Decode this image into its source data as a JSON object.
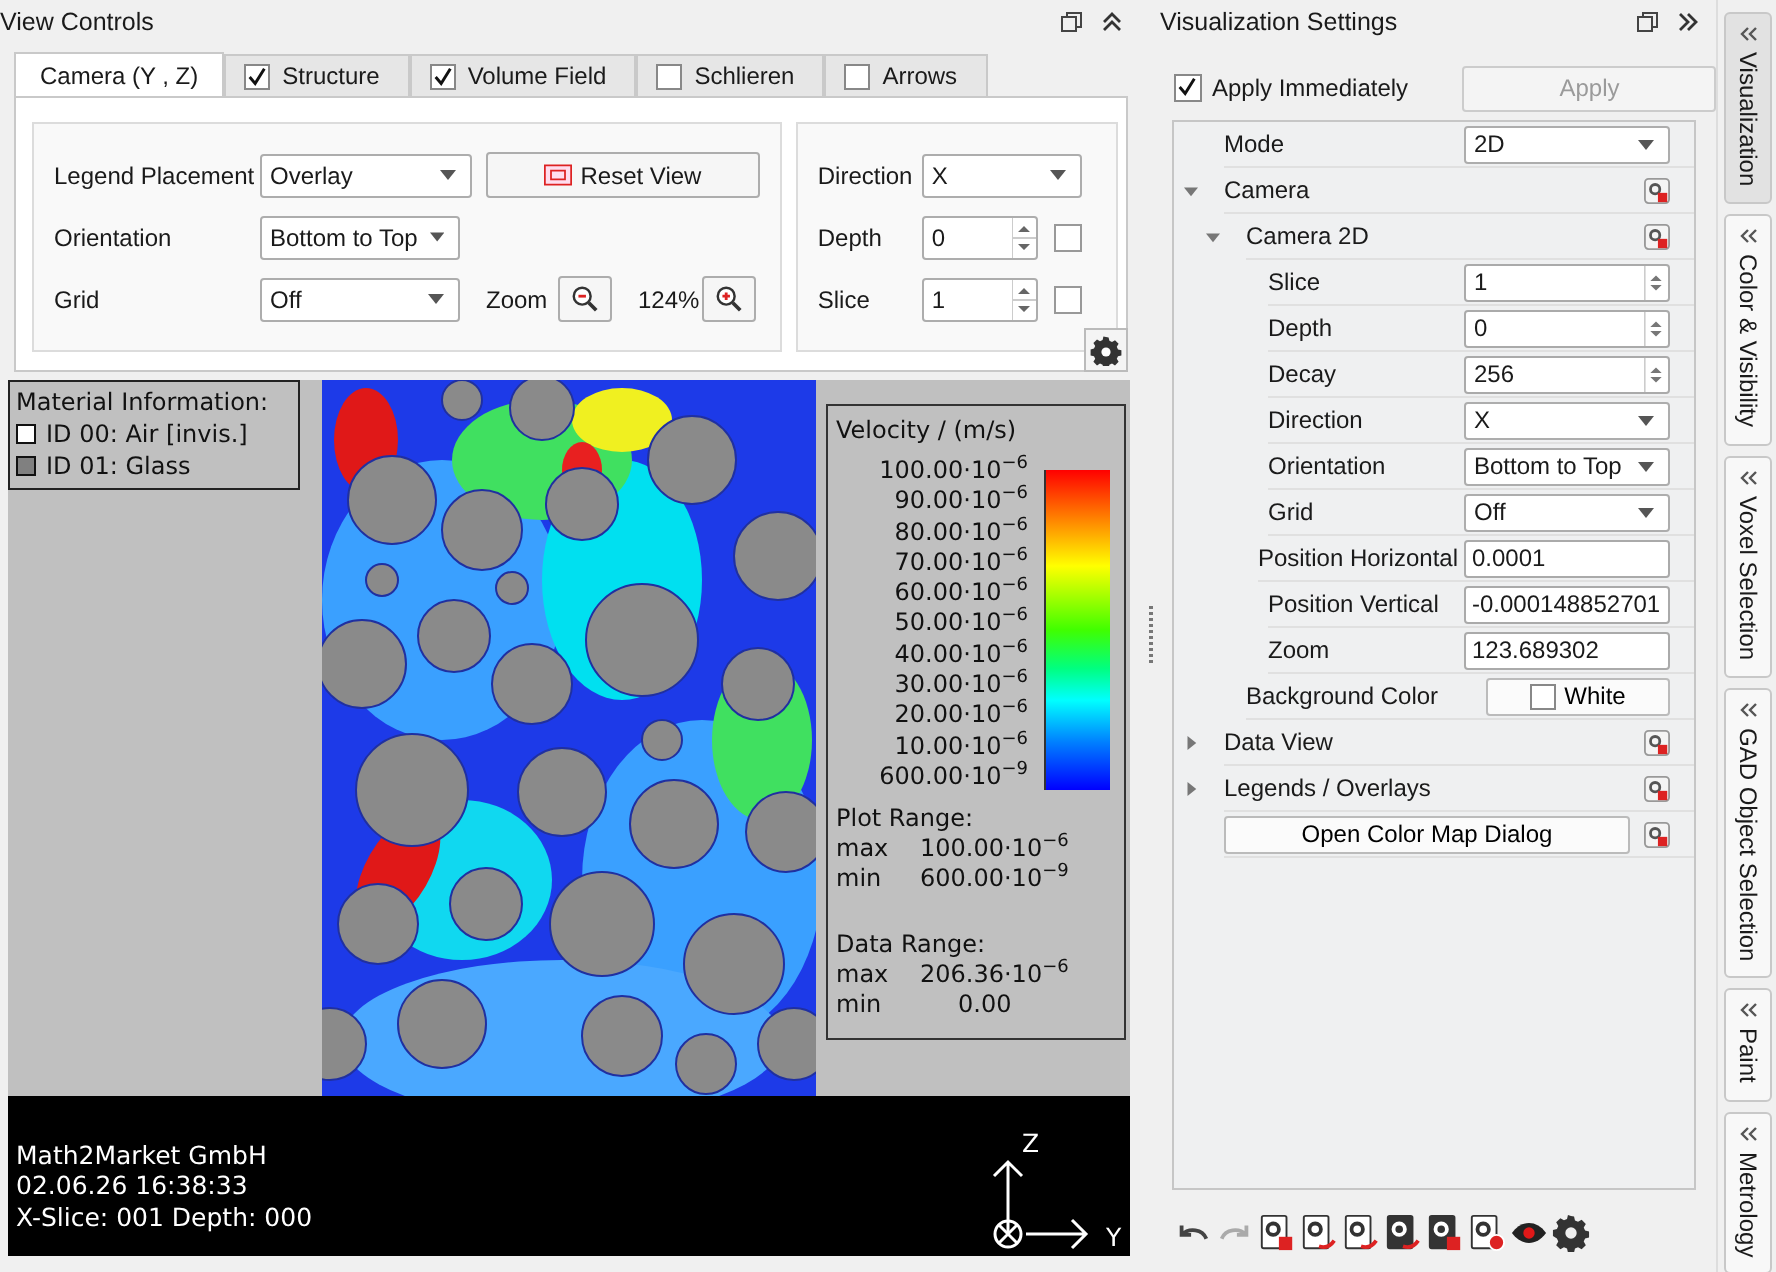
{
  "view_controls": {
    "title": "View Controls",
    "tabs": [
      {
        "kind": "plain",
        "label": "Camera (Y , Z)",
        "selected": true
      },
      {
        "kind": "check",
        "label": "Structure",
        "selected": false,
        "checked": true
      },
      {
        "kind": "check",
        "label": "Volume Field",
        "selected": false,
        "checked": true
      },
      {
        "kind": "check",
        "label": "Schlieren",
        "selected": false,
        "checked": false
      },
      {
        "kind": "check",
        "label": "Arrows",
        "selected": false,
        "checked": false
      }
    ],
    "camera": {
      "legend_placement": {
        "label": "Legend Placement",
        "value": "Overlay"
      },
      "reset_view": "Reset View",
      "orientation": {
        "label": "Orientation",
        "value": "Bottom to Top"
      },
      "grid": {
        "label": "Grid",
        "value": "Off"
      },
      "zoom": {
        "label": "Zoom",
        "value": "124%"
      },
      "direction": {
        "label": "Direction",
        "value": "X"
      },
      "depth": {
        "label": "Depth",
        "value": "0",
        "checked": false
      },
      "slice": {
        "label": "Slice",
        "value": "1",
        "checked": false
      }
    },
    "viewport": {
      "material_title": "Material Information:",
      "materials": [
        {
          "label": "ID 00: Air [invis.]",
          "color": "#ffffff"
        },
        {
          "label": "ID 01: Glass",
          "color": "#808080"
        }
      ],
      "legend": {
        "title": "Velocity / (m/s)",
        "ticks": [
          "100.00·10$^{−6}$",
          "90.00·10$^{−6}$",
          "80.00·10$^{−6}$",
          "70.00·10$^{−6}$",
          "60.00·10$^{−6}$",
          "50.00·10$^{−6}$",
          "40.00·10$^{−6}$",
          "30.00·10$^{−6}$",
          "20.00·10$^{−6}$",
          "10.00·10$^{−6}$",
          "600.00·10$^{−9}$"
        ],
        "plot_range_title": "Plot Range:",
        "plot_range": [
          {
            "label": "max",
            "value": "100.00·10$^{−6}$"
          },
          {
            "label": "min",
            "value": "600.00·10$^{−9}$"
          }
        ],
        "data_range_title": "Data Range:",
        "data_range": [
          {
            "label": "max",
            "value": "206.36·10$^{−6}$"
          },
          {
            "label": "min",
            "value": "0.00"
          }
        ]
      },
      "footer": [
        "Math2Market GmbH",
        "02.06.26 16:38:33",
        "X-Slice: 001 Depth: 000"
      ],
      "axes": {
        "up": "Z",
        "right": "Y"
      }
    }
  },
  "visualization_settings": {
    "title": "Visualization Settings",
    "apply_immediately": {
      "label": "Apply Immediately",
      "checked": true
    },
    "apply_button": {
      "label": "Apply",
      "disabled": true
    },
    "tree": [
      {
        "kind": "combo",
        "label": "Mode",
        "value": "2D"
      },
      {
        "kind": "group",
        "label": "Camera",
        "expanded": true,
        "children": [
          {
            "kind": "group",
            "label": "Camera 2D",
            "expanded": true,
            "children": [
              {
                "kind": "spin",
                "label": "Slice",
                "value": "1"
              },
              {
                "kind": "spin",
                "label": "Depth",
                "value": "0"
              },
              {
                "kind": "spin",
                "label": "Decay",
                "value": "256"
              },
              {
                "kind": "combo",
                "label": "Direction",
                "value": "X"
              },
              {
                "kind": "combo",
                "label": "Orientation",
                "value": "Bottom to Top"
              },
              {
                "kind": "combo",
                "label": "Grid",
                "value": "Off"
              },
              {
                "kind": "text",
                "label": "Position Horizontal",
                "value": "0.0001"
              },
              {
                "kind": "text",
                "label": "Position Vertical",
                "value": "-0.000148852701"
              },
              {
                "kind": "text",
                "label": "Zoom",
                "value": "123.689302"
              }
            ]
          },
          {
            "kind": "color",
            "label": "Background Color",
            "value": "White",
            "color": "#ffffff"
          }
        ]
      },
      {
        "kind": "group",
        "label": "Data View",
        "expanded": false
      },
      {
        "kind": "group",
        "label": "Legends / Overlays",
        "expanded": false
      },
      {
        "kind": "button",
        "label": "Open Color Map Dialog"
      }
    ]
  },
  "side_tabs": [
    {
      "label": "Visualization",
      "selected": true
    },
    {
      "label": "Color & Visibility",
      "selected": false
    },
    {
      "label": "Voxel Selection",
      "selected": false
    },
    {
      "label": "GAD Object Selection",
      "selected": false
    },
    {
      "label": "Paint",
      "selected": false
    },
    {
      "label": "Metrology",
      "selected": false
    }
  ]
}
